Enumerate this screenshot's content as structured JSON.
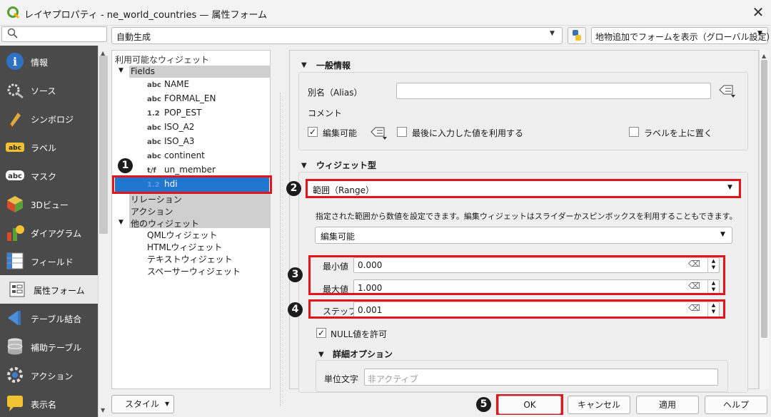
{
  "window": {
    "title": "レイヤプロパティ - ne_world_countries — 属性フォーム",
    "close": "✕"
  },
  "toolbar": {
    "layout_select": "自動生成",
    "form_mode_select": "地物追加でフォームを表示（グローバル設定）"
  },
  "sidebar": {
    "items": [
      {
        "label": "情報",
        "icon": "info-icon"
      },
      {
        "label": "ソース",
        "icon": "source-icon"
      },
      {
        "label": "シンボロジ",
        "icon": "symbology-icon"
      },
      {
        "label": "ラベル",
        "icon": "label-icon"
      },
      {
        "label": "マスク",
        "icon": "mask-icon"
      },
      {
        "label": "3Dビュー",
        "icon": "3d-view-icon"
      },
      {
        "label": "ダイアグラム",
        "icon": "diagram-icon"
      },
      {
        "label": "フィールド",
        "icon": "fields-icon"
      },
      {
        "label": "属性フォーム",
        "icon": "attribute-form-icon"
      },
      {
        "label": "テーブル結合",
        "icon": "join-icon"
      },
      {
        "label": "補助テーブル",
        "icon": "auxiliary-table-icon"
      },
      {
        "label": "アクション",
        "icon": "actions-icon"
      },
      {
        "label": "表示名",
        "icon": "display-icon"
      }
    ]
  },
  "tree": {
    "header": "利用可能なウィジェット",
    "fields_group": "Fields",
    "fields": [
      {
        "type": "abc",
        "name": "NAME"
      },
      {
        "type": "abc",
        "name": "FORMAL_EN"
      },
      {
        "type": "1.2",
        "name": "POP_EST"
      },
      {
        "type": "abc",
        "name": "ISO_A2"
      },
      {
        "type": "abc",
        "name": "ISO_A3"
      },
      {
        "type": "abc",
        "name": "continent"
      },
      {
        "type": "t/f",
        "name": "un_member"
      },
      {
        "type": "1.2",
        "name": "hdi"
      }
    ],
    "relations": "リレーション",
    "actions": "アクション",
    "other_group": "他のウィジェット",
    "other": [
      "QMLウィジェット",
      "HTMLウィジェット",
      "テキストウィジェット",
      "スペーサーウィジェット"
    ]
  },
  "general": {
    "section": "一般情報",
    "alias_label": "別名（Alias）",
    "alias_value": "",
    "comment_label": "コメント",
    "editable_label": "編集可能",
    "editable_checked": true,
    "reuse_label": "最後に入力した値を利用する",
    "reuse_checked": false,
    "label_on_top": "ラベルを上に置く",
    "label_on_top_checked": false
  },
  "widget": {
    "section": "ウィジェット型",
    "type_value": "範囲（Range）",
    "description": "指定された範囲から数値を設定できます。編集ウィジェットはスライダーかスピンボックスを利用することもできます。",
    "editable_select": "編集可能",
    "min_label": "最小値",
    "min_value": "0.000",
    "max_label": "最大値",
    "max_value": "1.000",
    "step_label": "ステップ",
    "step_value": "0.001",
    "null_label": "NULL値を許可",
    "null_checked": true,
    "advanced_section": "詳細オプション",
    "suffix_label": "単位文字",
    "suffix_placeholder": "非アクティブ"
  },
  "footer": {
    "style_button": "スタイル",
    "ok": "OK",
    "cancel": "キャンセル",
    "apply": "適用",
    "help": "ヘルプ"
  },
  "annotations": {
    "b1": "1",
    "b2": "2",
    "b3": "3",
    "b4": "4",
    "b5": "5"
  },
  "colors": {
    "accent_red": "#e5141a",
    "selection_blue": "#1f77d0",
    "sidebar_bg": "#4a4a4a"
  }
}
